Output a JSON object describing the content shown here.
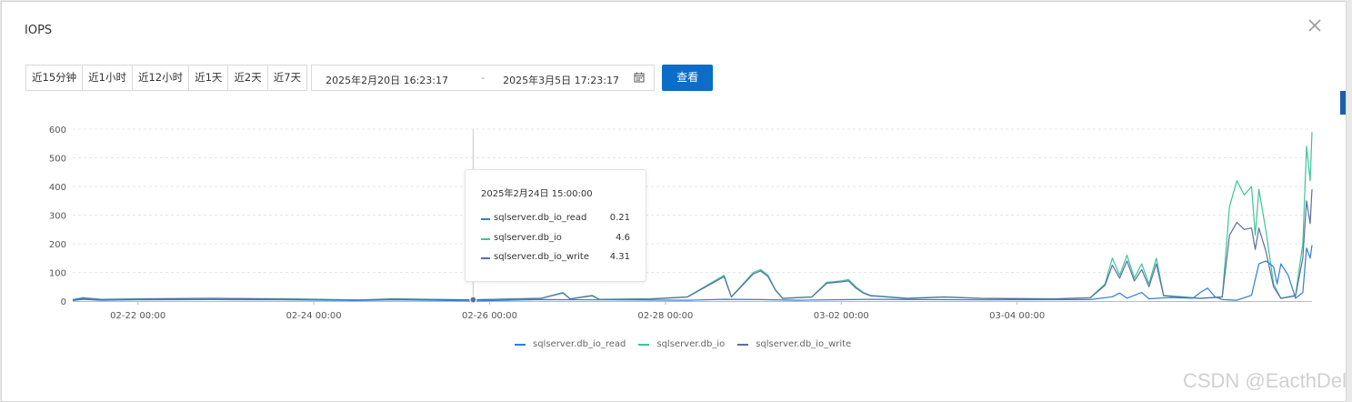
{
  "dialog": {
    "title": "IOPS",
    "close_icon": "close-icon"
  },
  "toolbar": {
    "ranges": [
      "近15分钟",
      "近1小时",
      "近12小时",
      "近1天",
      "近2天",
      "近7天"
    ],
    "start": "2025年2月20日 16:23:17",
    "separator": "-",
    "end": "2025年3月5日 17:23:17",
    "calendar_icon": "calendar-icon",
    "query_label": "查看"
  },
  "tooltip": {
    "title": "2025年2月24日 15:00:00",
    "rows": [
      {
        "name": "sqlserver.db_io_read",
        "value": "0.21"
      },
      {
        "name": "sqlserver.db_io",
        "value": "4.6"
      },
      {
        "name": "sqlserver.db_io_write",
        "value": "4.31"
      }
    ]
  },
  "watermark": "CSDN @EacthDel",
  "chart_data": {
    "type": "line",
    "ylim": [
      0,
      600
    ],
    "y_ticks": [
      "0",
      "100",
      "200",
      "300",
      "400",
      "500",
      "600"
    ],
    "x_ticks": [
      "02-22 00:00",
      "02-24 00:00",
      "02-26 00:00",
      "02-28 00:00",
      "03-02 00:00",
      "03-04 00:00"
    ],
    "xlim_hours": [
      -17.8,
      320.5
    ],
    "grid": true,
    "legend_position": "bottom",
    "series": [
      {
        "name": "sqlserver.db_io_read",
        "color": "#2f7ed8",
        "points": [
          [
            -17.8,
            2
          ],
          [
            -15,
            6
          ],
          [
            -10,
            3
          ],
          [
            0,
            4
          ],
          [
            20,
            5
          ],
          [
            40,
            4
          ],
          [
            60,
            2
          ],
          [
            70,
            4
          ],
          [
            80,
            3
          ],
          [
            91.5,
            0.21
          ],
          [
            110,
            5
          ],
          [
            130,
            4
          ],
          [
            150,
            3
          ],
          [
            160,
            6
          ],
          [
            170,
            5
          ],
          [
            180,
            3
          ],
          [
            200,
            6
          ],
          [
            230,
            4
          ],
          [
            260,
            5
          ],
          [
            266,
            15
          ],
          [
            268,
            28
          ],
          [
            270,
            10
          ],
          [
            274,
            30
          ],
          [
            276,
            8
          ],
          [
            282,
            12
          ],
          [
            288,
            10
          ],
          [
            290,
            30
          ],
          [
            292,
            45
          ],
          [
            294,
            15
          ],
          [
            296,
            5
          ],
          [
            300,
            3
          ],
          [
            304,
            20
          ],
          [
            306,
            130
          ],
          [
            308,
            140
          ],
          [
            310,
            120
          ],
          [
            311,
            60
          ],
          [
            312,
            130
          ],
          [
            314,
            90
          ],
          [
            316,
            10
          ],
          [
            318,
            30
          ],
          [
            319,
            185
          ],
          [
            320,
            150
          ],
          [
            320.5,
            195
          ]
        ]
      },
      {
        "name": "sqlserver.db_io",
        "color": "#3cc59a",
        "points": [
          [
            -17.8,
            5
          ],
          [
            -15,
            12
          ],
          [
            -10,
            6
          ],
          [
            0,
            8
          ],
          [
            20,
            10
          ],
          [
            40,
            8
          ],
          [
            60,
            4
          ],
          [
            70,
            8
          ],
          [
            80,
            6
          ],
          [
            91.5,
            4.6
          ],
          [
            110,
            10
          ],
          [
            116,
            30
          ],
          [
            118,
            8
          ],
          [
            124,
            20
          ],
          [
            126,
            6
          ],
          [
            140,
            8
          ],
          [
            150,
            15
          ],
          [
            160,
            90
          ],
          [
            162,
            15
          ],
          [
            168,
            100
          ],
          [
            170,
            110
          ],
          [
            172,
            90
          ],
          [
            174,
            40
          ],
          [
            176,
            10
          ],
          [
            184,
            15
          ],
          [
            188,
            65
          ],
          [
            192,
            70
          ],
          [
            194,
            75
          ],
          [
            196,
            50
          ],
          [
            198,
            30
          ],
          [
            200,
            20
          ],
          [
            210,
            10
          ],
          [
            220,
            15
          ],
          [
            230,
            10
          ],
          [
            250,
            8
          ],
          [
            260,
            12
          ],
          [
            264,
            60
          ],
          [
            266,
            150
          ],
          [
            268,
            90
          ],
          [
            270,
            160
          ],
          [
            272,
            80
          ],
          [
            274,
            130
          ],
          [
            276,
            60
          ],
          [
            278,
            150
          ],
          [
            280,
            20
          ],
          [
            290,
            10
          ],
          [
            296,
            15
          ],
          [
            298,
            330
          ],
          [
            300,
            420
          ],
          [
            302,
            370
          ],
          [
            304,
            400
          ],
          [
            305,
            230
          ],
          [
            306,
            390
          ],
          [
            308,
            240
          ],
          [
            310,
            60
          ],
          [
            312,
            10
          ],
          [
            316,
            20
          ],
          [
            318,
            200
          ],
          [
            319,
            540
          ],
          [
            320,
            420
          ],
          [
            320.5,
            590
          ]
        ]
      },
      {
        "name": "sqlserver.db_io_write",
        "color": "#5a6fa2",
        "points": [
          [
            -17.8,
            4
          ],
          [
            -15,
            10
          ],
          [
            -10,
            5
          ],
          [
            0,
            7
          ],
          [
            20,
            9
          ],
          [
            40,
            7
          ],
          [
            60,
            3
          ],
          [
            70,
            7
          ],
          [
            80,
            5
          ],
          [
            91.5,
            4.31
          ],
          [
            110,
            9
          ],
          [
            116,
            28
          ],
          [
            118,
            7
          ],
          [
            124,
            18
          ],
          [
            126,
            5
          ],
          [
            140,
            7
          ],
          [
            150,
            14
          ],
          [
            160,
            85
          ],
          [
            162,
            14
          ],
          [
            168,
            95
          ],
          [
            170,
            105
          ],
          [
            172,
            85
          ],
          [
            174,
            38
          ],
          [
            176,
            9
          ],
          [
            184,
            14
          ],
          [
            188,
            62
          ],
          [
            192,
            67
          ],
          [
            194,
            70
          ],
          [
            196,
            45
          ],
          [
            198,
            28
          ],
          [
            200,
            18
          ],
          [
            210,
            9
          ],
          [
            220,
            14
          ],
          [
            230,
            9
          ],
          [
            250,
            7
          ],
          [
            260,
            11
          ],
          [
            264,
            55
          ],
          [
            266,
            125
          ],
          [
            268,
            80
          ],
          [
            270,
            140
          ],
          [
            272,
            70
          ],
          [
            274,
            110
          ],
          [
            276,
            50
          ],
          [
            278,
            130
          ],
          [
            280,
            18
          ],
          [
            290,
            9
          ],
          [
            296,
            14
          ],
          [
            298,
            230
          ],
          [
            300,
            275
          ],
          [
            302,
            250
          ],
          [
            304,
            255
          ],
          [
            305,
            180
          ],
          [
            306,
            255
          ],
          [
            308,
            170
          ],
          [
            310,
            50
          ],
          [
            312,
            9
          ],
          [
            316,
            18
          ],
          [
            318,
            150
          ],
          [
            319,
            350
          ],
          [
            320,
            270
          ],
          [
            320.5,
            390
          ]
        ]
      }
    ]
  }
}
